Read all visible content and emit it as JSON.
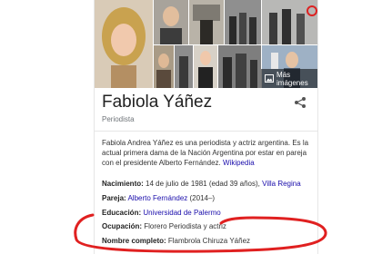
{
  "knowledge_panel": {
    "more_images_label": "Más imágenes",
    "title": "Fabiola Yáñez",
    "subtitle": "Periodista",
    "description": {
      "text": "Fabiola Andrea Yáñez es una periodista y actriz argentina. Es la actual primera dama de la Nación Argentina por estar en pareja con el presidente Alberto Fernández. ",
      "source_link": "Wikipedia"
    },
    "facts": [
      {
        "label": "Nacimiento:",
        "value": " 14 de julio de 1981 (edad 39 años), ",
        "link": "Villa Regina"
      },
      {
        "label": "Pareja:",
        "value": " ",
        "link": "Alberto Fernández",
        "suffix": " (2014–)"
      },
      {
        "label": "Educación:",
        "value": " ",
        "link": "Universidad de Palermo"
      },
      {
        "label": "Ocupación:",
        "value": " Florero Periodista y actriz"
      },
      {
        "label": "Nombre completo:",
        "value": " Flambrola Chiruza Yáñez"
      }
    ]
  },
  "colors": {
    "link": "#1a0dab",
    "annotation": "#e02020"
  },
  "icons": [
    "image-icon",
    "share-icon"
  ]
}
